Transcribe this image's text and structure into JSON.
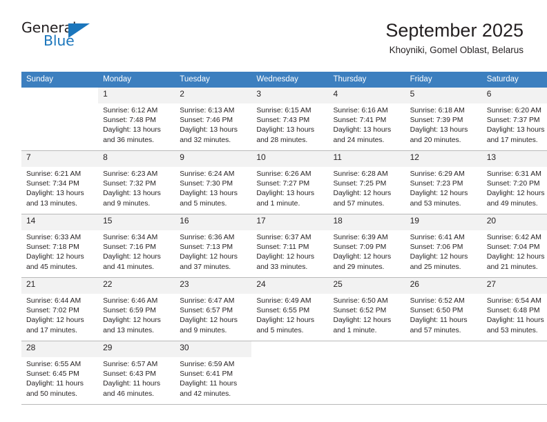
{
  "brand": {
    "word_dark": "General",
    "word_blue": "Blue",
    "triangle_color": "#1b76bc"
  },
  "header": {
    "title": "September 2025",
    "subtitle": "Khoyniki, Gomel Oblast, Belarus"
  },
  "theme": {
    "header_blue": "#3c7fbf",
    "daynum_bg": "#f2f2f2",
    "row_divider": "#b8b8b8",
    "text": "#231f20"
  },
  "weekday_headers": [
    "Sunday",
    "Monday",
    "Tuesday",
    "Wednesday",
    "Thursday",
    "Friday",
    "Saturday"
  ],
  "weeks": [
    [
      {
        "day": "",
        "sunrise": "",
        "sunset": "",
        "daylight_line1": "",
        "daylight_line2": ""
      },
      {
        "day": "1",
        "sunrise": "Sunrise: 6:12 AM",
        "sunset": "Sunset: 7:48 PM",
        "daylight_line1": "Daylight: 13 hours",
        "daylight_line2": "and 36 minutes."
      },
      {
        "day": "2",
        "sunrise": "Sunrise: 6:13 AM",
        "sunset": "Sunset: 7:46 PM",
        "daylight_line1": "Daylight: 13 hours",
        "daylight_line2": "and 32 minutes."
      },
      {
        "day": "3",
        "sunrise": "Sunrise: 6:15 AM",
        "sunset": "Sunset: 7:43 PM",
        "daylight_line1": "Daylight: 13 hours",
        "daylight_line2": "and 28 minutes."
      },
      {
        "day": "4",
        "sunrise": "Sunrise: 6:16 AM",
        "sunset": "Sunset: 7:41 PM",
        "daylight_line1": "Daylight: 13 hours",
        "daylight_line2": "and 24 minutes."
      },
      {
        "day": "5",
        "sunrise": "Sunrise: 6:18 AM",
        "sunset": "Sunset: 7:39 PM",
        "daylight_line1": "Daylight: 13 hours",
        "daylight_line2": "and 20 minutes."
      },
      {
        "day": "6",
        "sunrise": "Sunrise: 6:20 AM",
        "sunset": "Sunset: 7:37 PM",
        "daylight_line1": "Daylight: 13 hours",
        "daylight_line2": "and 17 minutes."
      }
    ],
    [
      {
        "day": "7",
        "sunrise": "Sunrise: 6:21 AM",
        "sunset": "Sunset: 7:34 PM",
        "daylight_line1": "Daylight: 13 hours",
        "daylight_line2": "and 13 minutes."
      },
      {
        "day": "8",
        "sunrise": "Sunrise: 6:23 AM",
        "sunset": "Sunset: 7:32 PM",
        "daylight_line1": "Daylight: 13 hours",
        "daylight_line2": "and 9 minutes."
      },
      {
        "day": "9",
        "sunrise": "Sunrise: 6:24 AM",
        "sunset": "Sunset: 7:30 PM",
        "daylight_line1": "Daylight: 13 hours",
        "daylight_line2": "and 5 minutes."
      },
      {
        "day": "10",
        "sunrise": "Sunrise: 6:26 AM",
        "sunset": "Sunset: 7:27 PM",
        "daylight_line1": "Daylight: 13 hours",
        "daylight_line2": "and 1 minute."
      },
      {
        "day": "11",
        "sunrise": "Sunrise: 6:28 AM",
        "sunset": "Sunset: 7:25 PM",
        "daylight_line1": "Daylight: 12 hours",
        "daylight_line2": "and 57 minutes."
      },
      {
        "day": "12",
        "sunrise": "Sunrise: 6:29 AM",
        "sunset": "Sunset: 7:23 PM",
        "daylight_line1": "Daylight: 12 hours",
        "daylight_line2": "and 53 minutes."
      },
      {
        "day": "13",
        "sunrise": "Sunrise: 6:31 AM",
        "sunset": "Sunset: 7:20 PM",
        "daylight_line1": "Daylight: 12 hours",
        "daylight_line2": "and 49 minutes."
      }
    ],
    [
      {
        "day": "14",
        "sunrise": "Sunrise: 6:33 AM",
        "sunset": "Sunset: 7:18 PM",
        "daylight_line1": "Daylight: 12 hours",
        "daylight_line2": "and 45 minutes."
      },
      {
        "day": "15",
        "sunrise": "Sunrise: 6:34 AM",
        "sunset": "Sunset: 7:16 PM",
        "daylight_line1": "Daylight: 12 hours",
        "daylight_line2": "and 41 minutes."
      },
      {
        "day": "16",
        "sunrise": "Sunrise: 6:36 AM",
        "sunset": "Sunset: 7:13 PM",
        "daylight_line1": "Daylight: 12 hours",
        "daylight_line2": "and 37 minutes."
      },
      {
        "day": "17",
        "sunrise": "Sunrise: 6:37 AM",
        "sunset": "Sunset: 7:11 PM",
        "daylight_line1": "Daylight: 12 hours",
        "daylight_line2": "and 33 minutes."
      },
      {
        "day": "18",
        "sunrise": "Sunrise: 6:39 AM",
        "sunset": "Sunset: 7:09 PM",
        "daylight_line1": "Daylight: 12 hours",
        "daylight_line2": "and 29 minutes."
      },
      {
        "day": "19",
        "sunrise": "Sunrise: 6:41 AM",
        "sunset": "Sunset: 7:06 PM",
        "daylight_line1": "Daylight: 12 hours",
        "daylight_line2": "and 25 minutes."
      },
      {
        "day": "20",
        "sunrise": "Sunrise: 6:42 AM",
        "sunset": "Sunset: 7:04 PM",
        "daylight_line1": "Daylight: 12 hours",
        "daylight_line2": "and 21 minutes."
      }
    ],
    [
      {
        "day": "21",
        "sunrise": "Sunrise: 6:44 AM",
        "sunset": "Sunset: 7:02 PM",
        "daylight_line1": "Daylight: 12 hours",
        "daylight_line2": "and 17 minutes."
      },
      {
        "day": "22",
        "sunrise": "Sunrise: 6:46 AM",
        "sunset": "Sunset: 6:59 PM",
        "daylight_line1": "Daylight: 12 hours",
        "daylight_line2": "and 13 minutes."
      },
      {
        "day": "23",
        "sunrise": "Sunrise: 6:47 AM",
        "sunset": "Sunset: 6:57 PM",
        "daylight_line1": "Daylight: 12 hours",
        "daylight_line2": "and 9 minutes."
      },
      {
        "day": "24",
        "sunrise": "Sunrise: 6:49 AM",
        "sunset": "Sunset: 6:55 PM",
        "daylight_line1": "Daylight: 12 hours",
        "daylight_line2": "and 5 minutes."
      },
      {
        "day": "25",
        "sunrise": "Sunrise: 6:50 AM",
        "sunset": "Sunset: 6:52 PM",
        "daylight_line1": "Daylight: 12 hours",
        "daylight_line2": "and 1 minute."
      },
      {
        "day": "26",
        "sunrise": "Sunrise: 6:52 AM",
        "sunset": "Sunset: 6:50 PM",
        "daylight_line1": "Daylight: 11 hours",
        "daylight_line2": "and 57 minutes."
      },
      {
        "day": "27",
        "sunrise": "Sunrise: 6:54 AM",
        "sunset": "Sunset: 6:48 PM",
        "daylight_line1": "Daylight: 11 hours",
        "daylight_line2": "and 53 minutes."
      }
    ],
    [
      {
        "day": "28",
        "sunrise": "Sunrise: 6:55 AM",
        "sunset": "Sunset: 6:45 PM",
        "daylight_line1": "Daylight: 11 hours",
        "daylight_line2": "and 50 minutes."
      },
      {
        "day": "29",
        "sunrise": "Sunrise: 6:57 AM",
        "sunset": "Sunset: 6:43 PM",
        "daylight_line1": "Daylight: 11 hours",
        "daylight_line2": "and 46 minutes."
      },
      {
        "day": "30",
        "sunrise": "Sunrise: 6:59 AM",
        "sunset": "Sunset: 6:41 PM",
        "daylight_line1": "Daylight: 11 hours",
        "daylight_line2": "and 42 minutes."
      },
      {
        "day": "",
        "sunrise": "",
        "sunset": "",
        "daylight_line1": "",
        "daylight_line2": ""
      },
      {
        "day": "",
        "sunrise": "",
        "sunset": "",
        "daylight_line1": "",
        "daylight_line2": ""
      },
      {
        "day": "",
        "sunrise": "",
        "sunset": "",
        "daylight_line1": "",
        "daylight_line2": ""
      },
      {
        "day": "",
        "sunrise": "",
        "sunset": "",
        "daylight_line1": "",
        "daylight_line2": ""
      }
    ]
  ]
}
